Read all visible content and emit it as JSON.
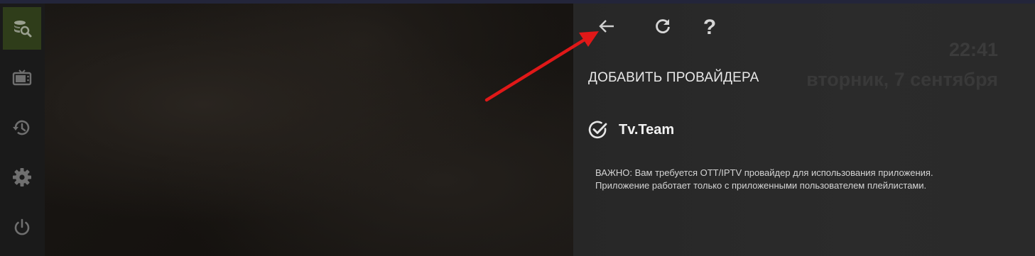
{
  "sidebar": {
    "items": [
      {
        "name": "sidebar-item-search-providers",
        "icon": "database-search-icon",
        "active": true
      },
      {
        "name": "sidebar-item-tv",
        "icon": "tv-icon",
        "active": false
      },
      {
        "name": "sidebar-item-history",
        "icon": "history-icon",
        "active": false
      },
      {
        "name": "sidebar-item-settings",
        "icon": "gear-icon",
        "active": false
      },
      {
        "name": "sidebar-item-power",
        "icon": "power-icon",
        "active": false
      }
    ],
    "active_color": "#2f3d1a"
  },
  "toolbar": {
    "back_icon": "arrow-left-icon",
    "refresh_icon": "refresh-icon",
    "help_icon": "question-icon",
    "help_glyph": "?"
  },
  "clock": {
    "time": "22:41",
    "date": "вторник, 7 сентября"
  },
  "main": {
    "title": "ДОБАВИТЬ ПРОВАЙДЕРА",
    "providers": [
      {
        "name": "Tv.Team",
        "selected": true,
        "icon": "check-circle-icon"
      }
    ],
    "notice_lines": [
      "ВАЖНО: Вам требуется OTT/IPTV провайдер для использования приложения.",
      "Приложение работает только с приложенными пользователем плейлистами."
    ]
  },
  "annotation": {
    "type": "red-arrow",
    "color": "#e01818",
    "points_to": "back-button"
  }
}
